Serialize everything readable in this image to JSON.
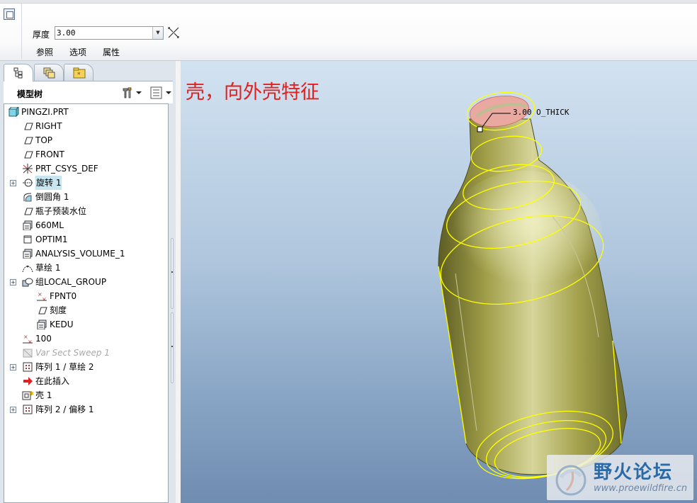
{
  "dashboard": {
    "thickness_label": "厚度",
    "thickness_value": "3.00",
    "tabs": [
      "参照",
      "选项",
      "属性"
    ]
  },
  "navigator": {
    "tabs": [
      "model-tree-tab",
      "layer-tree-tab",
      "favorites-folder-tab"
    ],
    "title": "模型树"
  },
  "tree": {
    "root": "PINGZI.PRT",
    "items": [
      {
        "label": "RIGHT",
        "icon": "datum-plane-icon",
        "expand": false
      },
      {
        "label": "TOP",
        "icon": "datum-plane-icon",
        "expand": false
      },
      {
        "label": "FRONT",
        "icon": "datum-plane-icon",
        "expand": false
      },
      {
        "label": "PRT_CSYS_DEF",
        "icon": "csys-icon",
        "expand": false
      },
      {
        "label": "旋转 1",
        "icon": "revolve-icon",
        "expand": true,
        "selected": true
      },
      {
        "label": "倒圆角 1",
        "icon": "round-icon",
        "expand": false
      },
      {
        "label": "瓶子预装水位",
        "icon": "datum-plane-icon",
        "expand": false
      },
      {
        "label": "660ML",
        "icon": "analysis-icon",
        "expand": false
      },
      {
        "label": "OPTIM1",
        "icon": "optimization-icon",
        "expand": false
      },
      {
        "label": "ANALYSIS_VOLUME_1",
        "icon": "analysis-icon",
        "expand": false
      },
      {
        "label": "草绘 1",
        "icon": "sketch-icon",
        "expand": false
      },
      {
        "label": "组LOCAL_GROUP",
        "icon": "group-icon",
        "expand": true
      },
      {
        "label": "FPNT0",
        "icon": "datum-point-icon",
        "indent": 1
      },
      {
        "label": "刻度",
        "icon": "datum-plane-icon",
        "indent": 1
      },
      {
        "label": "KEDU",
        "icon": "analysis-icon",
        "indent": 1
      },
      {
        "label": "100",
        "icon": "datum-point-icon",
        "expand": false
      },
      {
        "label": "Var Sect Sweep 1",
        "icon": "sweep-icon",
        "suppressed": true
      },
      {
        "label": "阵列 1 / 草绘 2",
        "icon": "pattern-icon",
        "expand": true
      },
      {
        "label": "在此插入",
        "icon": "insert-arrow-icon",
        "expand": false
      },
      {
        "label": "壳 1",
        "icon": "shell-icon",
        "expand": false
      },
      {
        "label": "阵列 2 / 偏移 1",
        "icon": "pattern-icon",
        "expand": true
      }
    ]
  },
  "viewport": {
    "caption": "壳，向外壳特征",
    "dimension_label": "3.00 O_THICK",
    "watermark_title": "野火论坛",
    "watermark_url": "www.proewildfire.cn"
  },
  "colors": {
    "bottle_body": "#9c9a42",
    "edge_highlight": "#ffff00",
    "caption_red": "#e12020",
    "selected_row": "#c8e6f0"
  }
}
